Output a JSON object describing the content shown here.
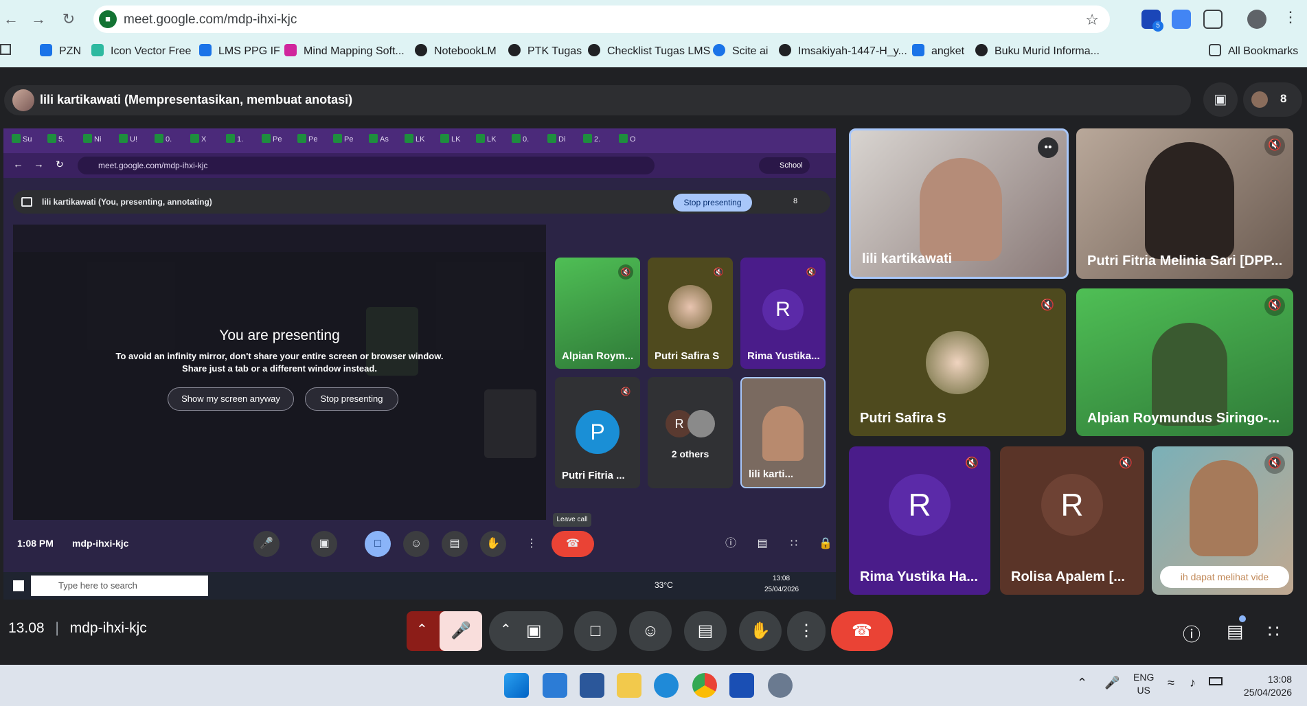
{
  "browser": {
    "url": "meet.google.com/mdp-ihxi-kjc",
    "bookmarks": [
      "PZN",
      "Icon Vector Free",
      "LMS PPG IF",
      "Mind Mapping Soft...",
      "NotebookLM",
      "PTK Tugas",
      "Checklist Tugas LMS",
      "Scite ai",
      "Imsakiyah-1447-H_y...",
      "angket",
      "Buku Murid Informa..."
    ],
    "all_bookmarks": "All Bookmarks",
    "ext_badge": "5"
  },
  "meet": {
    "presenter_banner": "lili kartikawati (Mempresentasikan, membuat anotasi)",
    "participant_count": "8",
    "time": "13.08",
    "code": "mdp-ihxi-kjc"
  },
  "presentation": {
    "inner_tabs": [
      "Su",
      "5.",
      "Ni",
      "U!",
      "0.",
      "X",
      "1.",
      "Pe",
      "Pe",
      "Pe",
      "As",
      "LK",
      "LK",
      "LK",
      "0.",
      "Di",
      "2.",
      "O"
    ],
    "inner_url": "meet.google.com/mdp-ihxi-kjc",
    "inner_profile": "School",
    "inner_banner": "lili kartikawati (You, presenting, annotating)",
    "stop_presenting": "Stop presenting",
    "inner_count": "8",
    "title": "You are presenting",
    "body_line1": "To avoid an infinity mirror, don't share your entire screen or browser window.",
    "body_line2": "Share just a tab or a different window instead.",
    "show_anyway": "Show my screen anyway",
    "stop_button": "Stop presenting",
    "inner_time": "1:08 PM",
    "inner_code": "mdp-ihxi-kjc",
    "tooltip": "Leave call",
    "tiles": [
      {
        "name": "Alpian Roym..."
      },
      {
        "name": "Putri Safira S"
      },
      {
        "name": "Rima Yustika...",
        "initial": "R"
      },
      {
        "name": "Putri Fitria ...",
        "initial": "P"
      },
      {
        "name": "2 others",
        "initial": "R"
      },
      {
        "name": "lili karti..."
      }
    ],
    "taskbar_search": "Type here to search",
    "weather": "33°C",
    "tb_time": "13:08",
    "tb_date": "25/04/2026"
  },
  "participants": [
    {
      "name": "lili kartikawati"
    },
    {
      "name": "Putri Fitria Melinia Sari [DPP..."
    },
    {
      "name": "Putri Safira S"
    },
    {
      "name": "Alpian Roymundus Siringo-..."
    },
    {
      "name": "Rima Yustika Ha...",
      "initial": "R"
    },
    {
      "name": "Rolisa Apalem [...",
      "initial": "R"
    },
    {
      "caption": "ih dapat melihat vide"
    }
  ],
  "system": {
    "lang1": "ENG",
    "lang2": "US",
    "time": "13:08",
    "date": "25/04/2026"
  }
}
